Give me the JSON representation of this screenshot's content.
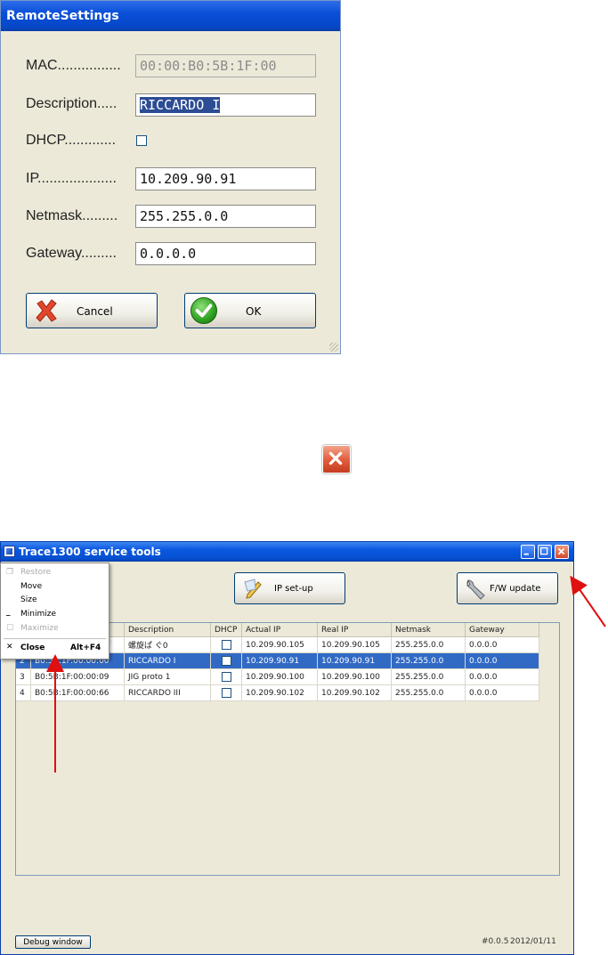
{
  "remote_settings": {
    "title": "RemoteSettings",
    "mac_label": "MAC................",
    "mac_value": "00:00:B0:5B:1F:00",
    "description_label": "Description.....",
    "description_value": "RICCARDO I",
    "dhcp_label": "DHCP.............",
    "dhcp_checked": false,
    "ip_label": "IP....................",
    "ip_value": "10.209.90.91",
    "netmask_label": "Netmask.........",
    "netmask_value": "255.255.0.0",
    "gateway_label": "Gateway.........",
    "gateway_value": "0.0.0.0",
    "cancel_label": "Cancel",
    "ok_label": "OK"
  },
  "close_icon": "close-icon",
  "app": {
    "title": "Trace1300 service tools",
    "ip_setup_label": "IP set-up",
    "fw_update_label": "F/W update",
    "columns": [
      "",
      "MAC",
      "Description",
      "DHCP",
      "Actual IP",
      "Real IP",
      "Netmask",
      "Gateway"
    ],
    "rows": [
      {
        "n": "1",
        "mac": "B0:5B:1F:00:00:0A",
        "desc": "螺旋ぱ ぐ0",
        "dhcp": false,
        "actual": "10.209.90.105",
        "real": "10.209.90.105",
        "mask": "255.255.0.0",
        "gw": "0.0.0.0"
      },
      {
        "n": "2",
        "mac": "B0:5B:1F:00:00:00",
        "desc": "RICCARDO I",
        "dhcp": false,
        "actual": "10.209.90.91",
        "real": "10.209.90.91",
        "mask": "255.255.0.0",
        "gw": "0.0.0.0"
      },
      {
        "n": "3",
        "mac": "B0:5B:1F:00:00:09",
        "desc": "JIG proto 1",
        "dhcp": false,
        "actual": "10.209.90.100",
        "real": "10.209.90.100",
        "mask": "255.255.0.0",
        "gw": "0.0.0.0"
      },
      {
        "n": "4",
        "mac": "B0:5B:1F:00:00:66",
        "desc": "RICCARDO III",
        "dhcp": false,
        "actual": "10.209.90.102",
        "real": "10.209.90.102",
        "mask": "255.255.0.0",
        "gw": "0.0.0.0"
      }
    ],
    "selected_row": 1,
    "debug_label": "Debug window",
    "version": "#0.0.5",
    "date": "2012/01/11"
  },
  "system_menu": {
    "restore": "Restore",
    "move": "Move",
    "size": "Size",
    "minimize": "Minimize",
    "maximize": "Maximize",
    "close": "Close",
    "close_shortcut": "Alt+F4"
  },
  "colors": {
    "titlebar": "#0a4fd8",
    "dialog_bg": "#ece9d8",
    "selection": "#316ac5",
    "arrow": "#e01010"
  }
}
